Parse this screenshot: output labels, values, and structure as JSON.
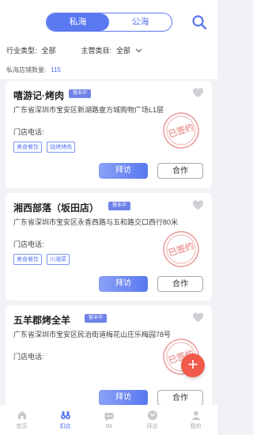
{
  "header": {
    "tabs": [
      {
        "label": "私海",
        "active": true
      },
      {
        "label": "公海",
        "active": false
      }
    ],
    "filters": {
      "industry_label": "行业类型:",
      "industry_value": "全部",
      "category_label": "主营类目:",
      "category_value": "全部"
    },
    "store_count_label": "私海店铺数量:",
    "store_count_value": "115"
  },
  "stores": [
    {
      "name": "嘻游记·烤肉",
      "status": "营业中",
      "address": "广东省深圳市宝安区新湖路壹方城购物广场L1层",
      "phone_label": "门店电话:",
      "tags": [
        "美食餐饮",
        "烧烤烤肉"
      ],
      "stamp": "已签约",
      "visit_label": "拜访",
      "coop_label": "合作"
    },
    {
      "name": "湘西部落（坂田店）",
      "status": "营业中",
      "address": "广东省深圳市宝安区永香西路与五和路交口西行80米",
      "phone_label": "门店电话:",
      "tags": [
        "美食餐饮",
        "川湘菜"
      ],
      "stamp": "已签约",
      "visit_label": "拜访",
      "coop_label": "合作"
    },
    {
      "name": "五羊郡烤全羊",
      "status": "营业中",
      "address": "广东省深圳市宝安区民治街道梅花山庄乐梅园78号",
      "phone_label": "门店电话:",
      "tags": [],
      "stamp": "已签约",
      "visit_label": "拜访",
      "coop_label": "合作"
    }
  ],
  "fab_icon": "plus-icon",
  "nav": [
    {
      "label": "首页",
      "icon": "home-icon",
      "active": false
    },
    {
      "label": "扣店",
      "icon": "binoculars-icon",
      "active": true
    },
    {
      "label": "IM",
      "icon": "chat-icon",
      "active": false
    },
    {
      "label": "拜访",
      "icon": "visit-icon",
      "active": false
    },
    {
      "label": "我的",
      "icon": "user-icon",
      "active": false
    }
  ],
  "colors": {
    "accent": "#5a78f0",
    "stamp_red": "#d9534f",
    "fab": "#f15a4a"
  }
}
